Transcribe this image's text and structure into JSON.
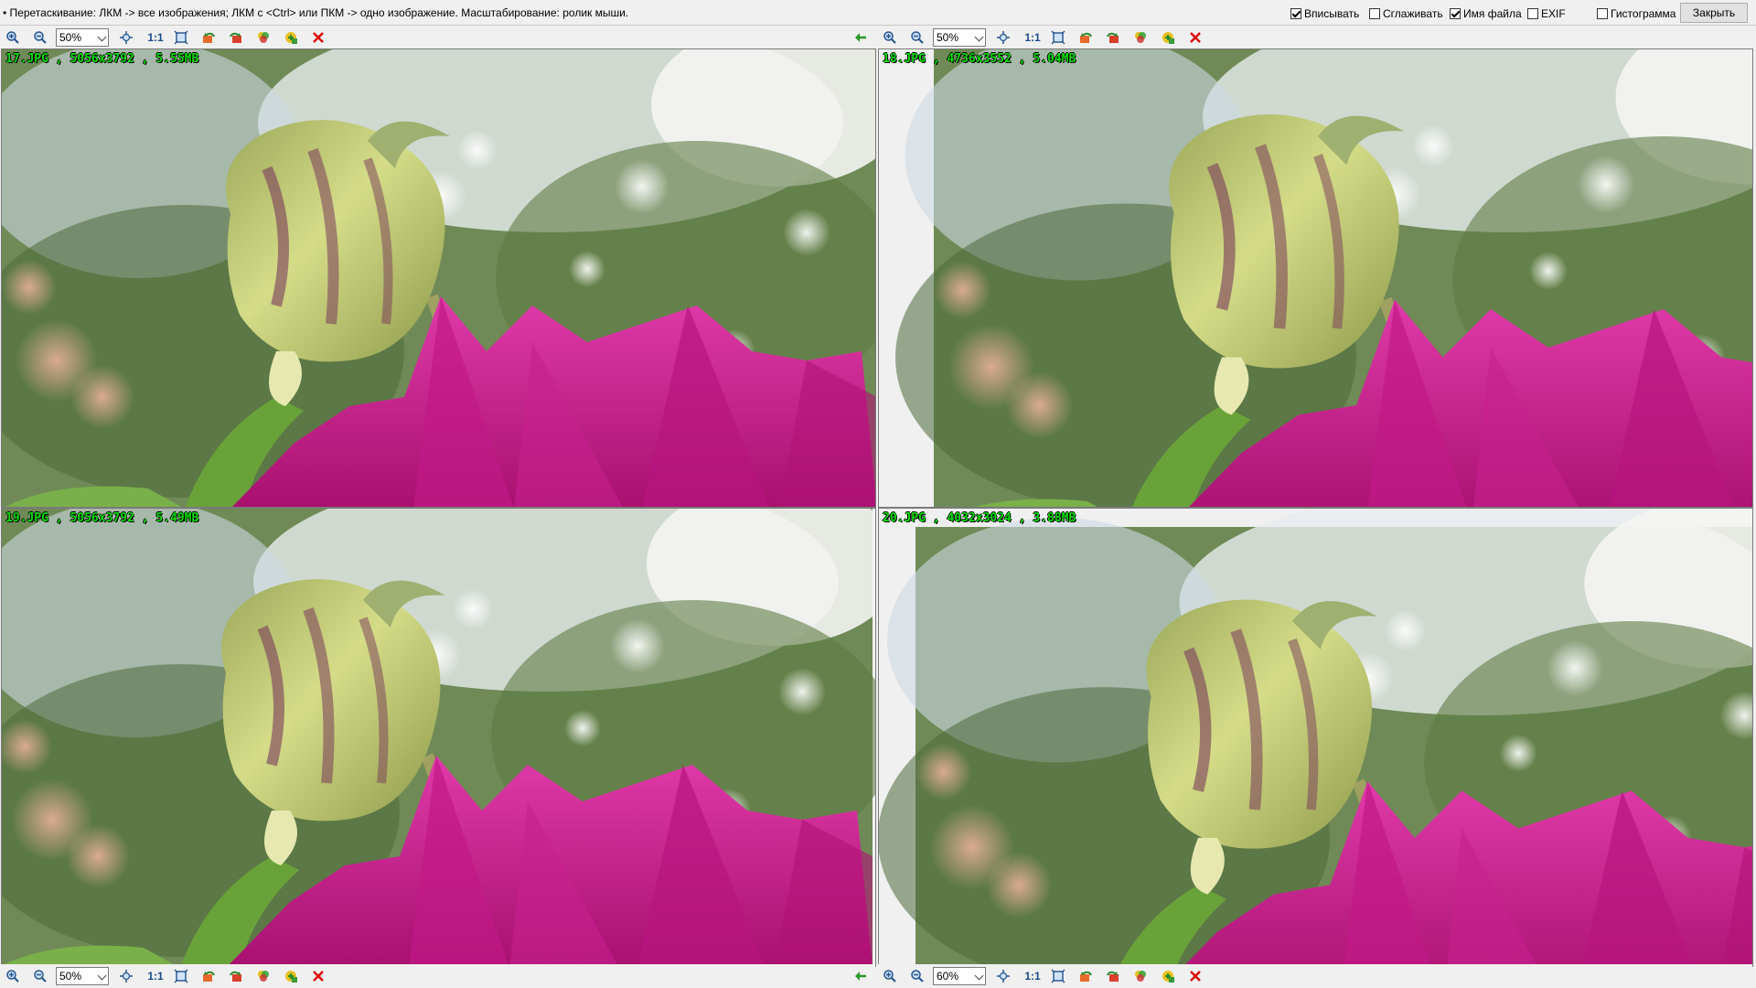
{
  "topbar": {
    "hint": "• Перетаскивание: ЛКМ -> все изображения; ЛКМ с <Ctrl> или ПКМ -> одно изображение. Масштабирование: ролик мыши.",
    "options": [
      {
        "label": "Вписывать",
        "checked": true
      },
      {
        "label": "Сглаживать",
        "checked": false
      },
      {
        "label": "Имя файла",
        "checked": true
      },
      {
        "label": "EXIF",
        "checked": false
      },
      {
        "label": "Гистограмма",
        "checked": false
      }
    ],
    "close_label": "Закрыть"
  },
  "toolbars": [
    {
      "zoom": "50%",
      "has_arrow": true
    },
    {
      "zoom": "50%",
      "has_arrow": false
    },
    {
      "zoom": "50%",
      "has_arrow": true
    },
    {
      "zoom": "60%",
      "has_arrow": false
    }
  ],
  "one_to_one_label": "1:1",
  "panes": [
    {
      "filename": "17.JPG , 5056x3792 , 5.55MB"
    },
    {
      "filename": "18.JPG , 4736x3552 , 5.04MB"
    },
    {
      "filename": "19.JPG , 5056x3792 , 5.49MB"
    },
    {
      "filename": "20.JPG , 4032x3024 , 3.88MB"
    }
  ],
  "icons": [
    "zoom-in-icon",
    "zoom-out-icon",
    "fit-icon",
    "one-to-one-icon",
    "fit-window-icon",
    "rotate-left-icon",
    "rotate-right-icon",
    "color-icon",
    "save-icon",
    "close-icon",
    "sync-arrow-icon"
  ],
  "colors": {
    "filename": "#00e000",
    "close_x": "#e00000",
    "petal": "#d01a9a",
    "bud": "#c8d47a"
  }
}
